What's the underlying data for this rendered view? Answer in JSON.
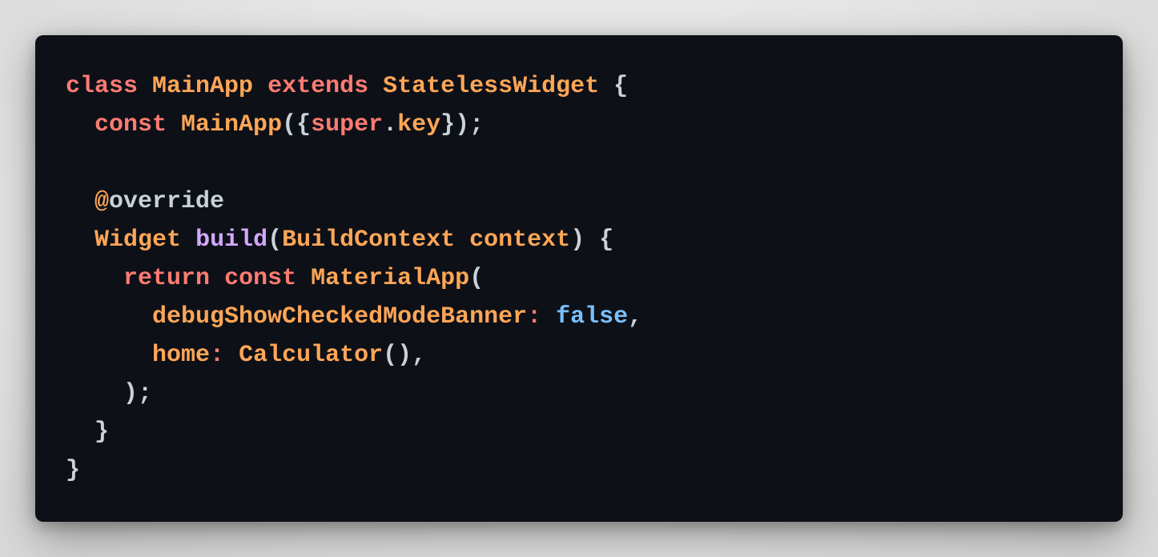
{
  "editor": {
    "language": "dart",
    "background": "#0d1017",
    "lines": [
      [
        {
          "t": "class",
          "k": "keyword"
        },
        {
          "t": " ",
          "k": "plain"
        },
        {
          "t": "MainApp",
          "k": "type"
        },
        {
          "t": " ",
          "k": "plain"
        },
        {
          "t": "extends",
          "k": "keyword"
        },
        {
          "t": " ",
          "k": "plain"
        },
        {
          "t": "StatelessWidget",
          "k": "type"
        },
        {
          "t": " {",
          "k": "punct"
        }
      ],
      [
        {
          "t": "  ",
          "k": "plain"
        },
        {
          "t": "const",
          "k": "keyword"
        },
        {
          "t": " ",
          "k": "plain"
        },
        {
          "t": "MainApp",
          "k": "type"
        },
        {
          "t": "({",
          "k": "punct"
        },
        {
          "t": "super",
          "k": "keyword"
        },
        {
          "t": ".",
          "k": "punct"
        },
        {
          "t": "key",
          "k": "param"
        },
        {
          "t": "});",
          "k": "punct"
        }
      ],
      [],
      [
        {
          "t": "  ",
          "k": "plain"
        },
        {
          "t": "@",
          "k": "annot-at"
        },
        {
          "t": "override",
          "k": "annot"
        }
      ],
      [
        {
          "t": "  ",
          "k": "plain"
        },
        {
          "t": "Widget",
          "k": "type"
        },
        {
          "t": " ",
          "k": "plain"
        },
        {
          "t": "build",
          "k": "func"
        },
        {
          "t": "(",
          "k": "punct"
        },
        {
          "t": "BuildContext",
          "k": "type"
        },
        {
          "t": " ",
          "k": "plain"
        },
        {
          "t": "context",
          "k": "param"
        },
        {
          "t": ") {",
          "k": "punct"
        }
      ],
      [
        {
          "t": "    ",
          "k": "plain"
        },
        {
          "t": "return",
          "k": "keyword"
        },
        {
          "t": " ",
          "k": "plain"
        },
        {
          "t": "const",
          "k": "keyword"
        },
        {
          "t": " ",
          "k": "plain"
        },
        {
          "t": "MaterialApp",
          "k": "type"
        },
        {
          "t": "(",
          "k": "punct"
        }
      ],
      [
        {
          "t": "      ",
          "k": "plain"
        },
        {
          "t": "debugShowCheckedModeBanner",
          "k": "param"
        },
        {
          "t": ":",
          "k": "prop"
        },
        {
          "t": " ",
          "k": "plain"
        },
        {
          "t": "false",
          "k": "bool"
        },
        {
          "t": ",",
          "k": "punct"
        }
      ],
      [
        {
          "t": "      ",
          "k": "plain"
        },
        {
          "t": "home",
          "k": "param"
        },
        {
          "t": ":",
          "k": "prop"
        },
        {
          "t": " ",
          "k": "plain"
        },
        {
          "t": "Calculator",
          "k": "type"
        },
        {
          "t": "(),",
          "k": "punct"
        }
      ],
      [
        {
          "t": "    ",
          "k": "plain"
        },
        {
          "t": ");",
          "k": "punct"
        }
      ],
      [
        {
          "t": "  ",
          "k": "plain"
        },
        {
          "t": "}",
          "k": "punct"
        }
      ],
      [
        {
          "t": "}",
          "k": "punct"
        }
      ]
    ]
  }
}
